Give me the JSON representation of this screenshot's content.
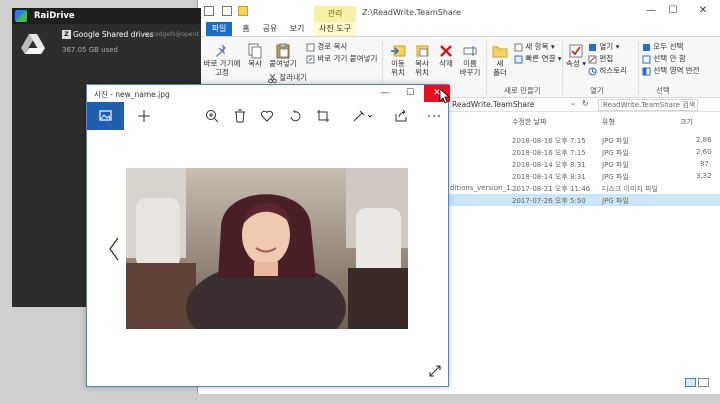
{
  "raidrive": {
    "app_title": "RaiDrive",
    "drive": {
      "letter": "Z",
      "name": "Google Shared drives",
      "account": "hyeunsdgefs@openbeta",
      "usage": "367.05 GB used"
    }
  },
  "explorer": {
    "contextual_tab": "관리",
    "title_path": "Z:\\ReadWrite.TeamShare",
    "tabs": [
      "파일",
      "홈",
      "공유",
      "보기",
      "사진 도구"
    ],
    "ribbon": {
      "pin_label": "바로 가기에\n고정",
      "copy_label": "복사",
      "paste_label": "붙여넣기",
      "copy_path_label": "경로 복사",
      "paste_shortcut_label": "바로 가기 붙여넣기",
      "cut_label": "잘라내기",
      "move_label": "이동\n위치",
      "copyto_label": "복사\n위치",
      "delete_label": "삭제",
      "rename_label": "이름\n바꾸기",
      "newfolder_label": "새\n폴더",
      "newitem_label": "새 항목",
      "easyaccess_label": "빠른 연결",
      "properties_label": "속성",
      "open_label": "열기",
      "edit_label": "편집",
      "history_label": "히스토리",
      "selectall_label": "모두 선택",
      "selectnone_label": "선택 안 함",
      "invert_label": "선택 영역 반전",
      "group_new": "새로 만들기",
      "group_open": "열기",
      "group_select": "선택"
    },
    "address": "ReadWrite.TeamShare",
    "search_placeholder": "ReadWrite.TeamShare 검색",
    "columns": {
      "date": "수정한 날짜",
      "type": "유형",
      "size": "크기"
    },
    "files": [
      {
        "name": "",
        "date": "2018-08-16 오후 7:15",
        "type": "JPG 파일",
        "size": "2,86"
      },
      {
        "name": "",
        "date": "2018-08-16 오후 7:15",
        "type": "JPG 파일",
        "size": "2,60"
      },
      {
        "name": "",
        "date": "2018-08-14 오후 8:31",
        "type": "JPG 파일",
        "size": "87"
      },
      {
        "name": "",
        "date": "2018-08-14 오후 8:31",
        "type": "JPG 파일",
        "size": "3,32"
      },
      {
        "name": "ditions_version_1...",
        "date": "2017-08-21 오후 11:46",
        "type": "디스크 이미지 파일",
        "size": ""
      },
      {
        "name": "",
        "date": "2017-07-26 오후 5:50",
        "type": "JPG 파일",
        "size": ""
      }
    ]
  },
  "photos": {
    "title": "사진 - new_name.jpg",
    "colors": {
      "accent": "#1f5fae",
      "close": "#e81123"
    }
  }
}
